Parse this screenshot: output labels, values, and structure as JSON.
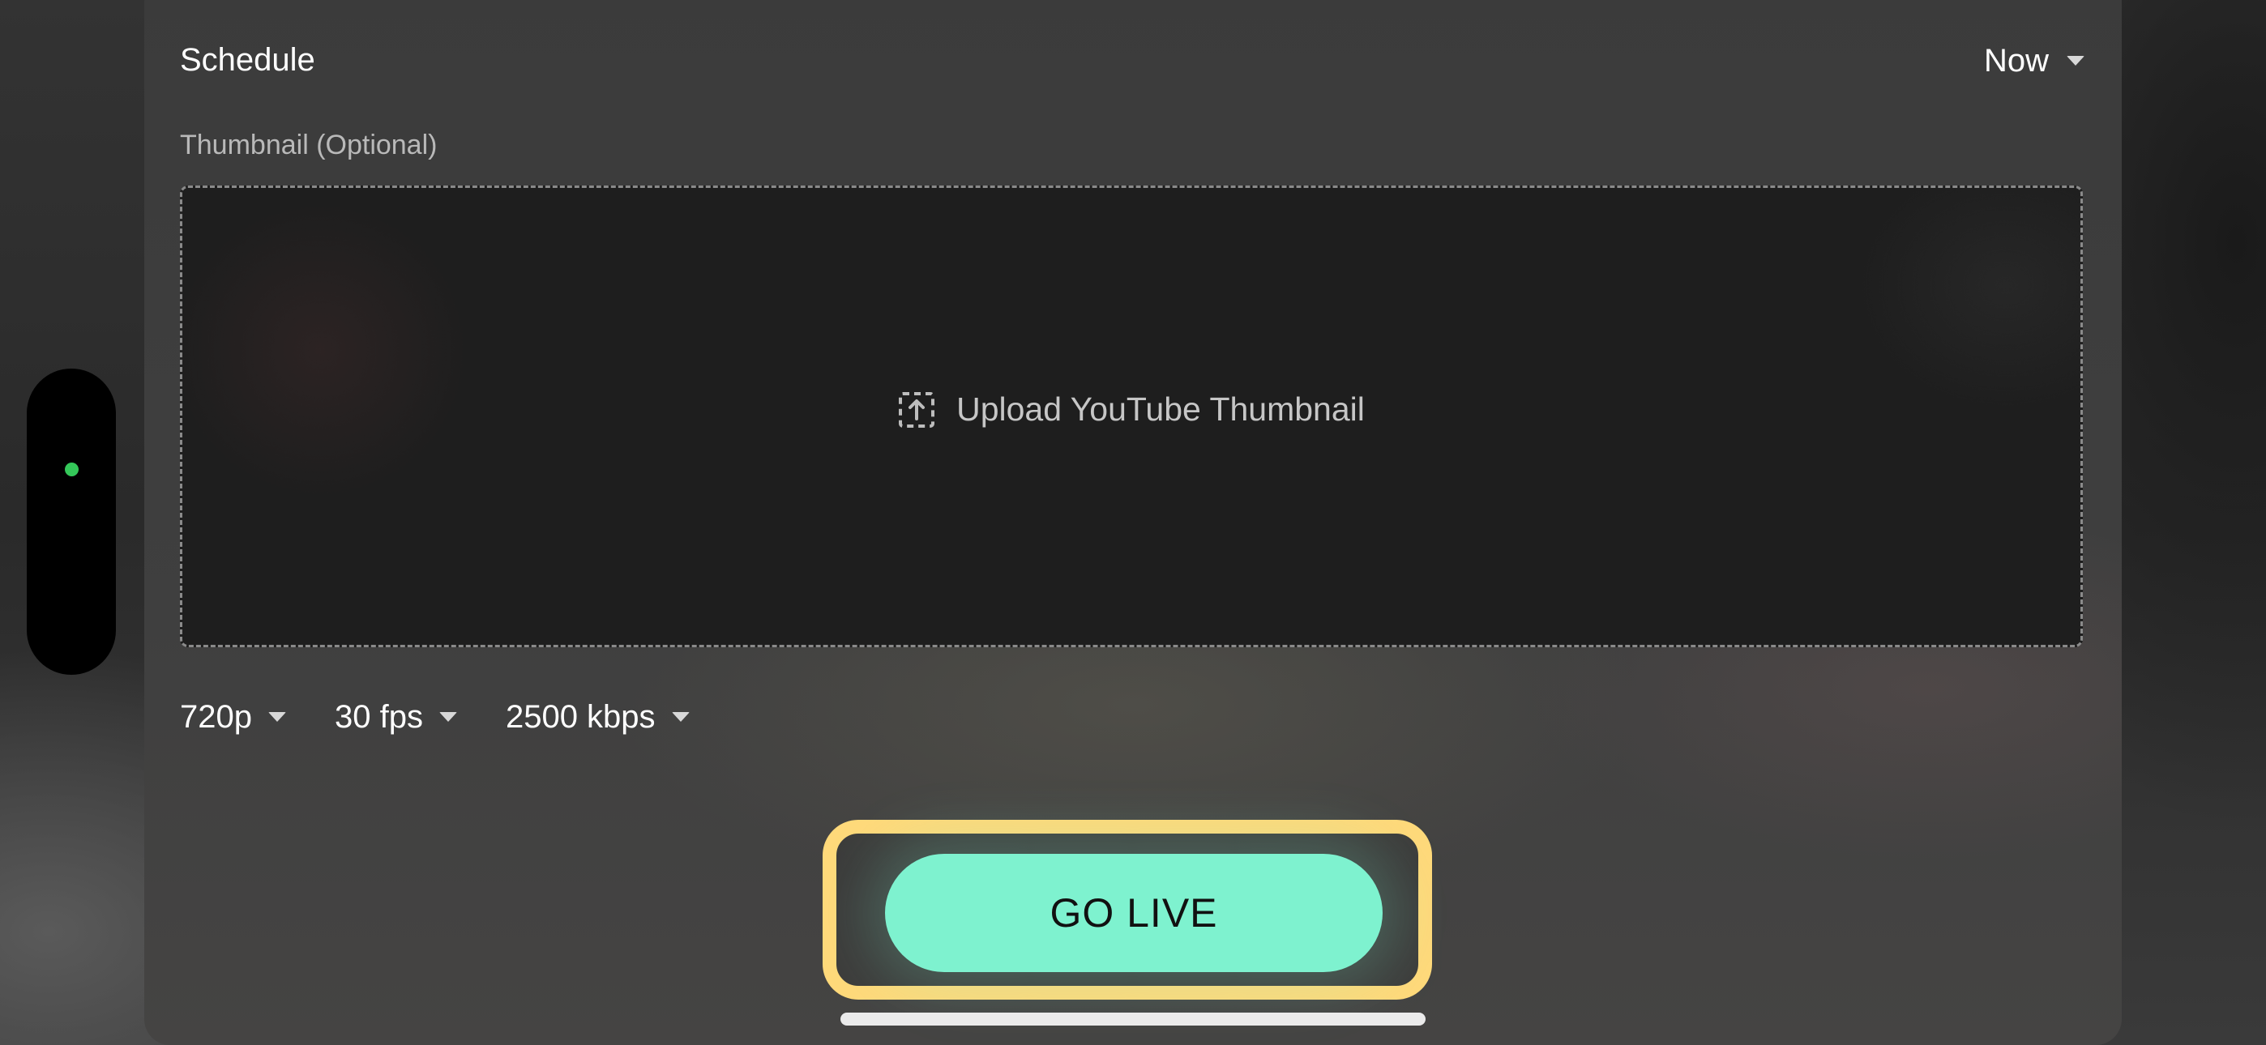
{
  "schedule": {
    "label": "Schedule",
    "value": "Now"
  },
  "thumbnail": {
    "label": "Thumbnail (Optional)",
    "upload_text": "Upload YouTube Thumbnail"
  },
  "quality": {
    "resolution": "720p",
    "framerate": "30 fps",
    "bitrate": "2500 kbps"
  },
  "actions": {
    "go_live_label": "GO LIVE"
  },
  "colors": {
    "accent": "#7ef2cf",
    "highlight": "#ffd97a",
    "status_dot": "#34c759",
    "panel": "#3d3d3d"
  },
  "icons": {
    "upload": "upload-dashed-box-icon",
    "dropdown": "caret-down-icon"
  }
}
